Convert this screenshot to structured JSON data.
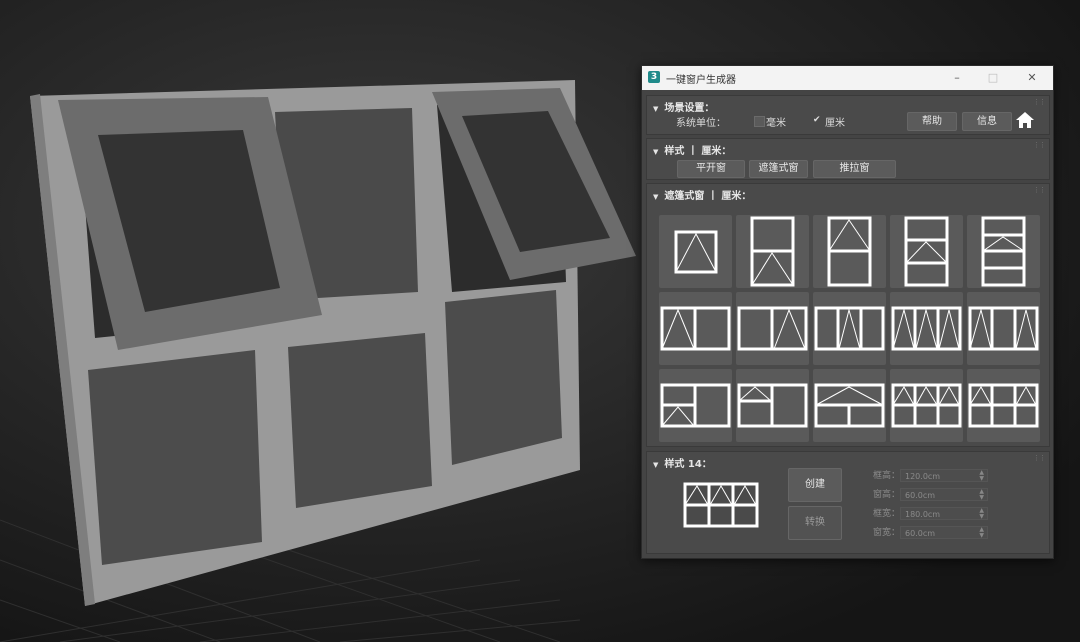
{
  "window": {
    "title": "一键窗户生成器",
    "logo": "3",
    "minimize_icon": "minimize-icon",
    "maximize_icon": "maximize-icon",
    "close_icon": "close-icon"
  },
  "scene": {
    "header": "场景设置：",
    "unit_label": "系统单位：",
    "unit_mm": "毫米",
    "unit_cm": "厘米",
    "selected_unit": "厘米",
    "help": "帮助",
    "info": "信息",
    "home_icon": "home-icon"
  },
  "style_section": {
    "header": "样式 丨 厘米：",
    "casement": "平开窗",
    "awning": "遮篷式窗",
    "sliding": "推拉窗"
  },
  "awning_section": {
    "header": "遮篷式窗 丨 厘米："
  },
  "selected_style": {
    "header": "样式 14：",
    "create": "创建",
    "convert": "转换",
    "fields": [
      {
        "label": "框高：",
        "value": "120.0cm"
      },
      {
        "label": "窗高：",
        "value": "60.0cm"
      },
      {
        "label": "框宽：",
        "value": "180.0cm"
      },
      {
        "label": "窗宽：",
        "value": "60.0cm"
      }
    ]
  },
  "colors": {
    "accent": "#1f8a8a",
    "panel": "#444444",
    "tile": "#5a5a5a"
  }
}
